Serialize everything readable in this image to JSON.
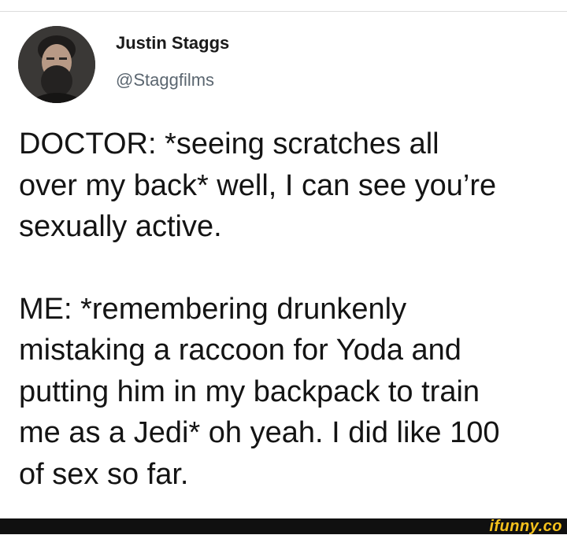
{
  "tweet": {
    "author_name": "Justin Staggs",
    "author_handle": "@Staggfilms",
    "paragraph_1": "DOCTOR: *seeing scratches all\nover my back* well, I can see you’re\nsexually active.",
    "paragraph_2": "ME: *remembering drunkenly\nmistaking a raccoon for Yoda and\nputting him in my backpack to train\nme as a Jedi* oh yeah. I did like 100\nof sex so far."
  },
  "watermark": {
    "text": "ifunny.co"
  },
  "colors": {
    "text": "#141414",
    "handle": "#5b6670",
    "footer": "#101010",
    "brand": "#f6c21c"
  }
}
